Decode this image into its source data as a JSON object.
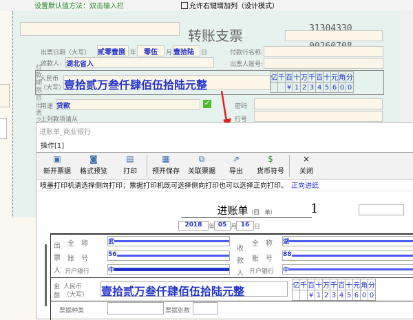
{
  "topbar": {
    "hint": "设置默认值方法：双击输入栏",
    "checkbox_label": "允许右键增加列（设计模式）",
    "checkbox_checked": false
  },
  "cheque": {
    "title": "转账支票",
    "code1": "31304330",
    "code2": "00260708",
    "date_label": "出票日期（大写）",
    "year": "贰零壹捌",
    "year_unit": "年",
    "month": "零伍",
    "month_unit": "月",
    "day": "壹拾陆",
    "day_unit": "日",
    "payee_label": "收款人:",
    "payee": "湖北省入",
    "bank_name_label": "付款行名称:",
    "account_label": "出票人账号:",
    "rmb_label": "人民币",
    "rmb_label2": "（大写）",
    "amount_words": "壹拾贰万叁仟肆佰伍拾陆元整",
    "digit_headers": [
      "亿",
      "千",
      "百",
      "十",
      "万",
      "千",
      "百",
      "十",
      "元",
      "角",
      "分"
    ],
    "digits": [
      "",
      "",
      "¥",
      "1",
      "2",
      "3",
      "4",
      "5",
      "6",
      "0",
      "0"
    ],
    "purpose_label": "用途",
    "purpose": "贷款",
    "password_label": "密码",
    "row_label": "行号",
    "from_label": "上列款项请从",
    "vertical_note": "付款期限自出票之日起十天"
  },
  "dialog": {
    "title": "进账单_商业银行",
    "menu": "操作[1]",
    "toolbar": [
      {
        "label": "新开票据",
        "icon": "new-doc-icon",
        "glyph": "▣"
      },
      {
        "label": "格式预览",
        "icon": "preview-icon",
        "glyph": "◙"
      },
      {
        "label": "打印",
        "icon": "print-icon",
        "glyph": "▤"
      },
      {
        "label": "预开保存",
        "icon": "save-icon",
        "glyph": "▦"
      },
      {
        "label": "关联票据",
        "icon": "link-icon",
        "glyph": "⧉"
      },
      {
        "label": "导出",
        "icon": "export-icon",
        "glyph": "⇗"
      },
      {
        "label": "货币符号",
        "icon": "dollar-icon",
        "glyph": "$"
      },
      {
        "label": "关闭",
        "icon": "close-icon",
        "glyph": "×"
      }
    ],
    "note": "喷墨打印机请选择侧向打印；票据打印机既可选择侧向打印也可以选择正向打印。",
    "feed_link": "正向进纸",
    "slip": {
      "title": "进账单",
      "subtitle": "（回　单）",
      "number": "1",
      "year": "2018",
      "year_unit": "年",
      "month": "05",
      "month_unit": "月",
      "day": "16",
      "day_unit": "日",
      "payer_label": "出票人",
      "payee_label": "收款人",
      "name_label": "全　称",
      "account_label": "账　号",
      "bank_label": "开户银行",
      "payer_name": "武",
      "payer_account": "56",
      "payer_bank": "中",
      "payee_name": "湖",
      "payee_account": "88",
      "payee_bank": "中",
      "amount_label": "金额",
      "rmb_label": "人民币",
      "rmb_label2": "（大写）",
      "amount_words": "壹拾贰万叁仟肆佰伍拾陆元整",
      "digit_headers": [
        "亿",
        "千",
        "百",
        "十",
        "万",
        "千",
        "百",
        "十",
        "元",
        "角",
        "分"
      ],
      "digits": [
        "",
        "",
        "¥",
        "1",
        "2",
        "3",
        "4",
        "5",
        "6",
        "0",
        "0"
      ],
      "type_label": "票据种类",
      "count_label": "票据张数"
    }
  }
}
